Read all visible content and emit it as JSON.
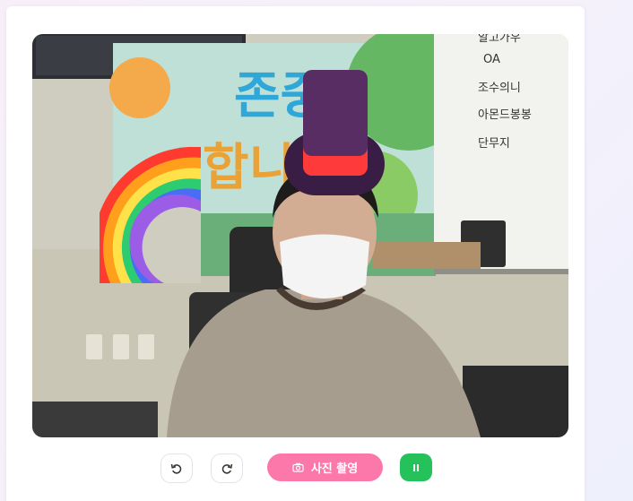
{
  "camera": {
    "whiteboard_items": [
      "알고가우",
      "OA",
      "조수의니",
      "아몬드봉봉",
      "단무지"
    ],
    "banner_text_top": "존중",
    "banner_text_bottom": "합니"
  },
  "stickers": [
    "rainbow-sticker",
    "top-hat-sticker"
  ],
  "controls": {
    "rotate_left_icon": "rotate-ccw-icon",
    "rotate_right_icon": "rotate-cw-icon",
    "capture_label": "사진 촬영",
    "capture_icon": "camera-icon",
    "pause_icon": "pause-icon",
    "accent_pink": "#fd78aa",
    "accent_green": "#25c25b"
  }
}
